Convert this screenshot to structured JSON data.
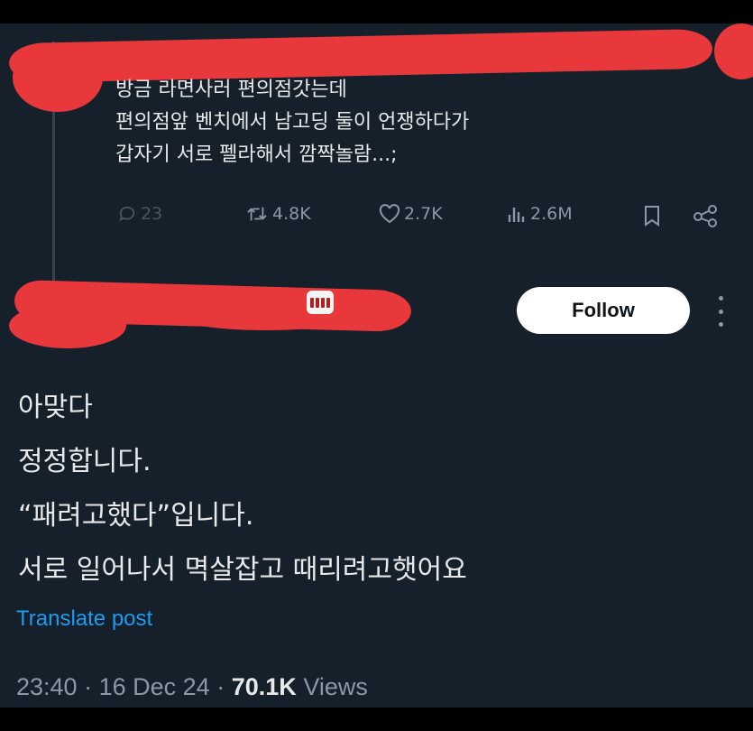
{
  "quoted_post": {
    "lines": [
      "방금 라면사러 편의점갓는데",
      "편의점앞 벤치에서 남고딩 둘이 언쟁하다가",
      "갑자기 서로 펠라해서 깜짝놀람...;"
    ],
    "actions": {
      "replies": "23",
      "reposts": "4.8K",
      "likes": "2.7K",
      "views": "2.6M"
    }
  },
  "author": {
    "follow_label": "Follow"
  },
  "post": {
    "lines": [
      "아맞다",
      "정정합니다.",
      "“패려고했다”입니다.",
      "서로 일어나서 멱살잡고 때리려고햇어요"
    ],
    "translate_label": "Translate post",
    "time": "23:40",
    "date": "16 Dec 24",
    "views_count": "70.1K",
    "views_label": "Views",
    "separator": "·"
  },
  "colors": {
    "background": "#15202b",
    "accent": "#1d9bf0",
    "redaction": "#e8383b",
    "muted": "#8b98a5"
  }
}
